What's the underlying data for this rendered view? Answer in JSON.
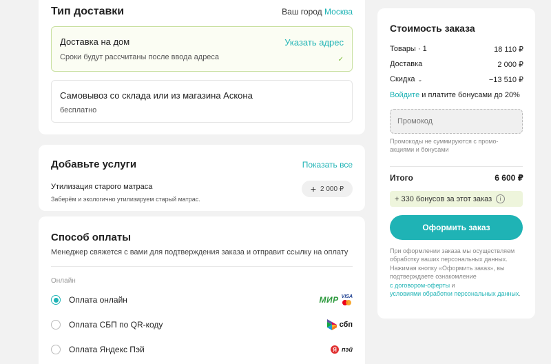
{
  "delivery": {
    "title": "Тип доставки",
    "city_label": "Ваш город",
    "city": "Москва",
    "home": {
      "title": "Доставка на дом",
      "subtitle": "Сроки будут рассчитаны после ввода адреса",
      "link": "Указать адрес",
      "selected": true
    },
    "pickup": {
      "title": "Самовывоз со склада или из магазина Аскона",
      "subtitle": "бесплатно"
    }
  },
  "services": {
    "title": "Добавьте услуги",
    "show_all": "Показать все",
    "item": {
      "name": "Утилизация старого матраса",
      "description": "Заберём и экологично утилизируем старый матрас.",
      "price": "2 000 ₽"
    }
  },
  "payment": {
    "title": "Способ оплаты",
    "subtitle": "Менеджер свяжется с вами для подтверждения заказа и отправит ссылку на оплату",
    "group_label": "Онлайн",
    "options": [
      {
        "label": "Оплата онлайн",
        "selected": true,
        "logo_text": [
          "МИР",
          "VISA"
        ]
      },
      {
        "label": "Оплата СБП по QR-коду",
        "selected": false,
        "logo_text": [
          "сбп"
        ]
      },
      {
        "label": "Оплата Яндекс Пэй",
        "selected": false,
        "logo_text": [
          "Я",
          "пэй"
        ]
      }
    ]
  },
  "summary": {
    "title": "Стоимость заказа",
    "goods_label": "Товары · 1",
    "goods_value": "18 110 ₽",
    "delivery_label": "Доставка",
    "delivery_value": "2 000 ₽",
    "discount_label": "Скидка",
    "discount_value": "−13 510 ₽",
    "login_link": "Войдите",
    "login_text": " и платите бонусами до 20%",
    "promo_placeholder": "Промокод",
    "promo_note": "Промокоды не суммируются с промо-акциями и бонусами",
    "total_label": "Итого",
    "total_value": "6 600 ₽",
    "bonus_text": "+ 330 бонусов за этот заказ",
    "checkout_label": "Оформить заказ",
    "legal_text": "При оформлении заказа мы осуществляем обработку ваших персональных данных. Нажимая кнопку «Оформить заказ», вы подтверждаете ознакомление",
    "legal_link1": "с договором-оферты",
    "legal_and": " и",
    "legal_link2": "условиями обработки персональных данных",
    "legal_end": "."
  },
  "colors": {
    "accent": "#1fb3b5",
    "selected_border": "#c8e0a0",
    "bonus_bg": "#eef5dc"
  }
}
